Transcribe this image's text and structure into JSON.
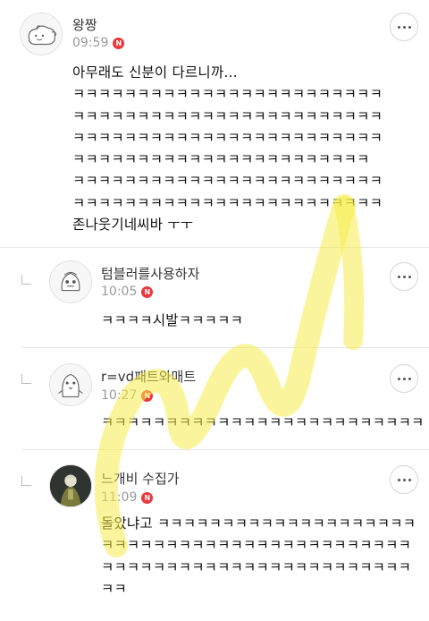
{
  "colors": {
    "new_badge": "#e8383d",
    "watermark": "#f6ec4a",
    "divider": "#e6e6e6"
  },
  "badge_label": "N",
  "comments": [
    {
      "author": "왕짱",
      "time": "09:59",
      "avatar_icon": "dog-sketch-avatar-icon",
      "is_reply": false,
      "body": "아무래도 신분이 다르니까...\nㅋㅋㅋㅋㅋㅋㅋㅋㅋㅋㅋㅋㅋㅋㅋㅋㅋㅋㅋㅋㅋㅋㅋㅋ\nㅋㅋㅋㅋㅋㅋㅋㅋㅋㅋㅋㅋㅋㅋㅋㅋㅋㅋㅋㅋㅋㅋㅋㅋ\nㅋㅋㅋㅋㅋㅋㅋㅋㅋㅋㅋㅋㅋㅋㅋㅋㅋㅋㅋㅋㅋㅋㅋㅋ\nㅋㅋㅋㅋㅋㅋㅋㅋㅋㅋㅋㅋㅋㅋㅋㅋㅋㅋㅋㅋㅋㅋㅋ\nㅋㅋㅋㅋㅋㅋㅋㅋㅋㅋㅋㅋㅋㅋㅋㅋㅋㅋㅋㅋㅋㅋㅋㅋ\nㅋㅋㅋㅋㅋㅋㅋㅋㅋㅋㅋㅋㅋㅋㅋㅋㅋㅋㅋㅋㅋㅋㅋㅋ\n존나웃기네씨바 ㅜㅜ"
    },
    {
      "author": "텀블러를사용하자",
      "time": "10:05",
      "avatar_icon": "character-sketch-avatar-icon",
      "is_reply": true,
      "body": "ㅋㅋㅋㅋ시발ㅋㅋㅋㅋㅋ"
    },
    {
      "author": "r=vd패트와매트",
      "time": "10:27",
      "avatar_icon": "penguin-sketch-avatar-icon",
      "is_reply": true,
      "body": "ㅋㅋㅋㅋㅋㅋㅋㅋㅋㅋㅋㅋㅋㅋㅋㅋㅋㅋㅋㅋㅋㅋㅋㅋㅋ"
    },
    {
      "author": "느개비 수집가",
      "time": "11:09",
      "avatar_icon": "photo-avatar-icon",
      "is_reply": true,
      "body": "돌았냐고 ㅋㅋㅋㅋㅋㅋㅋㅋㅋㅋㅋㅋㅋㅋㅋㅋㅋㅋㅋㅋ\nㅋㅋㅋㅋㅋㅋㅋㅋㅋㅋㅋㅋㅋㅋㅋㅋㅋㅋㅋㅋㅋㅋㅋㅋ\nㅋㅋㅋㅋㅋㅋㅋㅋㅋㅋㅋㅋㅋㅋㅋㅋㅋㅋㅋㅋㅋㅋㅋㅋ\nㅋㅋ"
    }
  ]
}
